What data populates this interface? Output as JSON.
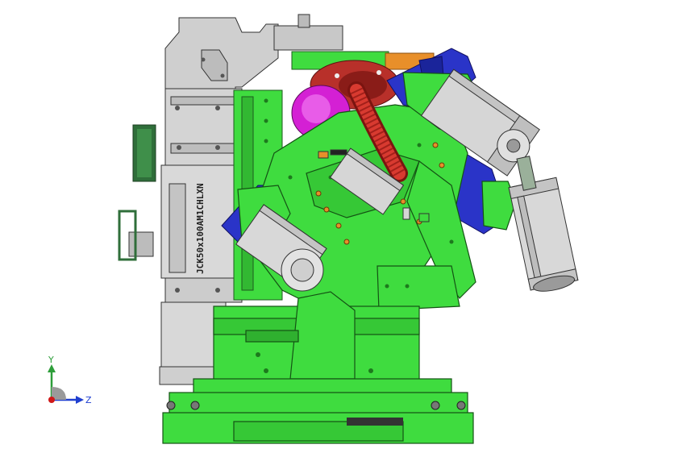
{
  "viewport": {
    "background": "#ffffff",
    "part_label": "JCK50x100AM1CHLXN"
  },
  "triad": {
    "y_label": "Y",
    "z_label": "Z",
    "y_color": "#2e9e3a",
    "z_color": "#1f3fd0",
    "x_color": "#d01818"
  },
  "colors": {
    "frame_gray": "#cfcfcf",
    "green": "#3fdc3f",
    "dark_green": "#1e8a1e",
    "blue": "#2a34c8",
    "magenta": "#d420d4",
    "red": "#c8322a",
    "cylinder": "#d6d6d6",
    "orange": "#e88f2a",
    "bracket": "#2f6e3a"
  }
}
